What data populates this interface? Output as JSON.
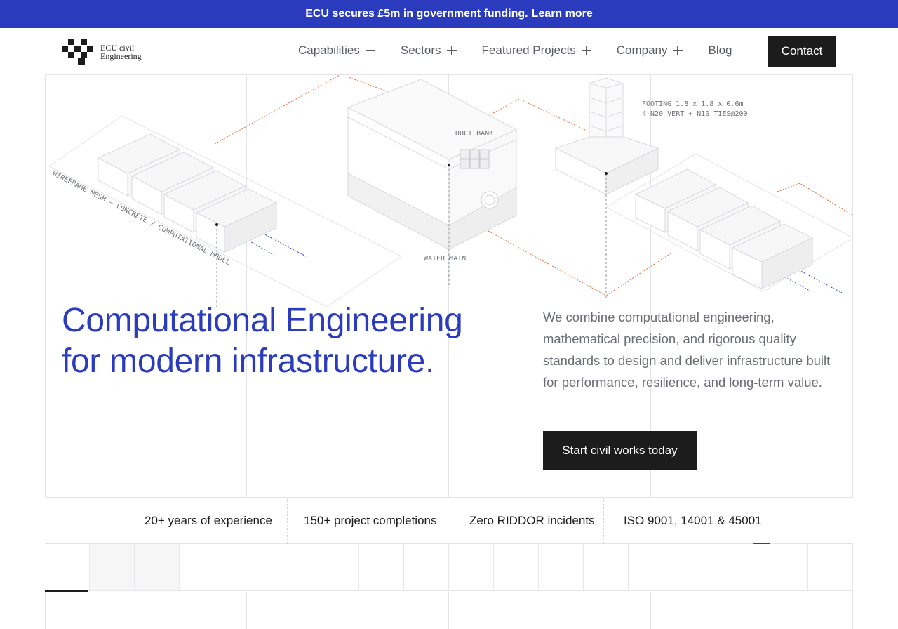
{
  "announcement": {
    "text": "ECU secures £5m in government funding.",
    "link_label": "Learn more"
  },
  "brand": {
    "line1": "ECU civil",
    "line2": "Engineering"
  },
  "nav": {
    "items": [
      {
        "label": "Capabilities",
        "has_submenu": true
      },
      {
        "label": "Sectors",
        "has_submenu": true
      },
      {
        "label": "Featured Projects",
        "has_submenu": true
      },
      {
        "label": "Company",
        "has_submenu": true
      },
      {
        "label": "Blog",
        "has_submenu": false
      }
    ],
    "contact_label": "Contact"
  },
  "illustration": {
    "labels": {
      "model": "WIREFRAME MESH — CONCRETE / COMPUTATIONAL MODEL",
      "duct": "DUCT BANK",
      "water": "WATER MAIN",
      "footing_line1": "FOOTING 1.8 x 1.8 x 0.6m",
      "footing_line2": "4-N20 VERT + N10 TIES@200"
    }
  },
  "hero": {
    "headline_line1": "Computational Engineering",
    "headline_line2": "for modern infrastructure.",
    "lede": "We combine computational engineering, mathematical precision, and rigorous quality standards to design and deliver infrastructure built for performance, resilience, and long-term value.",
    "cta_label": "Start civil works today"
  },
  "stats": [
    {
      "label": "20+ years of experience"
    },
    {
      "label": "150+ project completions"
    },
    {
      "label": "Zero RIDDOR incidents"
    },
    {
      "label": "ISO 9001, 14001 & 45001"
    }
  ],
  "colors": {
    "accent": "#2a3cbd",
    "dark": "#1c1c1c",
    "muted_text": "#6a6d73",
    "orange_dash": "#e0703a",
    "blue_dash": "#2a3cbd"
  }
}
